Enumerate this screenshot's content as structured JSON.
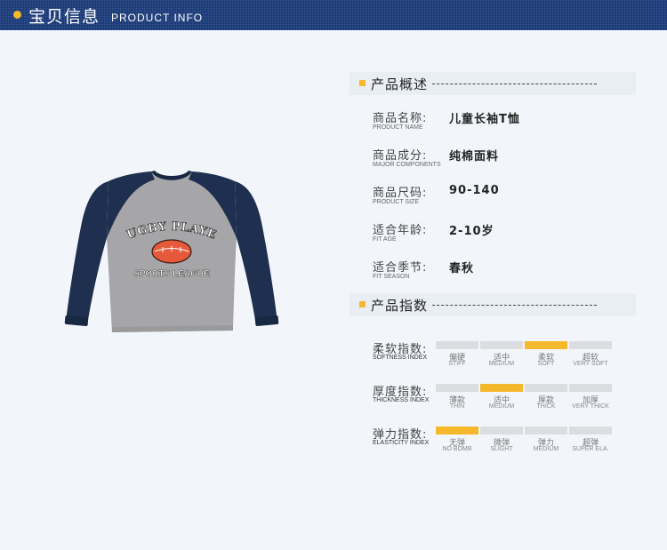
{
  "header": {
    "title_cn": "宝贝信息",
    "title_en": "PRODUCT INFO"
  },
  "product_image": {
    "print_top": "RUGBY PLAYER",
    "print_bottom": "SPORTS LEAGUE",
    "colors": {
      "body": "#a6a6a8",
      "sleeves": "#1e2f4f",
      "ball": "#e65a3b"
    }
  },
  "overview": {
    "title": "产品概述",
    "rows": [
      {
        "cn": "商品名称:",
        "en": "PRODUCT NAME",
        "value": "儿童长袖T恤"
      },
      {
        "cn": "商品成分:",
        "en": "MAJOR COMPONENTS",
        "value": "纯棉面料"
      },
      {
        "cn": "商品尺码:",
        "en": "PRODUCT SIZE",
        "value": "90-140"
      },
      {
        "cn": "适合年龄:",
        "en": "FIT AGE",
        "value": "2-10岁"
      },
      {
        "cn": "适合季节:",
        "en": "FIT SEASON",
        "value": "春秋"
      }
    ]
  },
  "index": {
    "title": "产品指数",
    "rows": [
      {
        "cn": "柔软指数:",
        "en": "SOFTNESS INDEX",
        "active": 2,
        "levels": [
          {
            "cn": "偏硬",
            "en": "STIFF"
          },
          {
            "cn": "适中",
            "en": "MEDIUM"
          },
          {
            "cn": "柔软",
            "en": "SOFT"
          },
          {
            "cn": "超软",
            "en": "VERY SOFT"
          }
        ]
      },
      {
        "cn": "厚度指数:",
        "en": "THICKNESS INDEX",
        "active": 1,
        "levels": [
          {
            "cn": "薄款",
            "en": "THIN"
          },
          {
            "cn": "适中",
            "en": "MEDIUM"
          },
          {
            "cn": "厚款",
            "en": "THICK"
          },
          {
            "cn": "加厚",
            "en": "VERY THICK"
          }
        ]
      },
      {
        "cn": "弹力指数:",
        "en": "ELASTICITY INDEX",
        "active": 0,
        "levels": [
          {
            "cn": "无弹",
            "en": "NO BOMB"
          },
          {
            "cn": "微弹",
            "en": "SLIGHT"
          },
          {
            "cn": "弹力",
            "en": "MEDIUM"
          },
          {
            "cn": "超弹",
            "en": "SUPER ELA."
          }
        ]
      }
    ]
  },
  "colors": {
    "accent": "#f5b82b",
    "header_bg": "#1b3a78",
    "inactive_bar": "#dcdde0"
  }
}
